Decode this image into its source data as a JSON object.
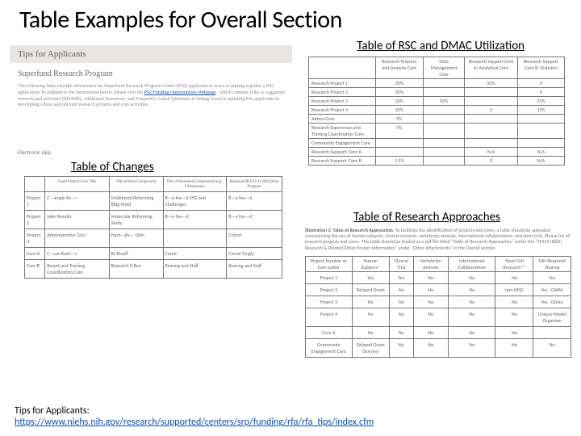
{
  "title": "Table Examples for Overall Section",
  "subheads": {
    "rsc": "Table of RSC and DMAC Utilization",
    "changes": "Table of Changes",
    "approaches": "Table of Research Approaches"
  },
  "tipsBanner": "Tips for Applicants",
  "srpHead": "Superfund Research Program",
  "srpBody": {
    "t1": "The following links provide information for Superfund Research Program Center (P42) applicants to assist in putting together a P42 application. In addition to the information below, please visit the ",
    "link": "P42 Funding Opportunities Webpage",
    "t2": ", which contains links to suggested research and activities (BH4DB), Additional Resources, and Frequently Asked Questions (Coming Soon) to assisting P42 applicants in developing robust and relevant research projects and core activities."
  },
  "elecApp": "Electronic App",
  "rsc": {
    "head": [
      "",
      "Research Projects and Analysis Core",
      "Data Management Core",
      "Research Support Core A: Analytical Core",
      "Research Support Core B: Statistics"
    ],
    "rows": [
      [
        "Research Project 1",
        "20%",
        "",
        "50%",
        "0"
      ],
      [
        "Research Project 2",
        "20%",
        "",
        "",
        "0"
      ],
      [
        "Research Project 3",
        "20%",
        "50%",
        "",
        "33%"
      ],
      [
        "Research Project 4",
        "20%",
        "",
        "C",
        "33%"
      ],
      [
        "Admin Core",
        "5%",
        "",
        "",
        ""
      ],
      [
        "Research Experience and Training Coordination Core",
        "5%",
        "",
        "",
        ""
      ],
      [
        "Community Engagement Core",
        "",
        "",
        "",
        ""
      ],
      [
        "Research Support: Core A",
        "",
        "",
        "N/A",
        "N/A"
      ],
      [
        "Research Support: Core B",
        "2.5%",
        "",
        "0",
        "N/A"
      ]
    ]
  },
  "changes": {
    "head": [
      "",
      "Grant Project Core Title",
      "Title of New Component",
      "Title of Renewed Component (e.g., P42xxxxxxx)",
      "Renewal (RFA ES 14-002) New Program "
    ],
    "rows": [
      [
        "Project 1",
        "C—single Rx—r",
        "Multifaced Reforming Bldg Mold",
        "B—e hw—d S9G and Challenges",
        "B—e hw—d"
      ],
      [
        "Project 2",
        "Infer Results",
        "Molecular Reforming Study",
        "B—e hw—d",
        "B—e hw—d"
      ],
      [
        "Project 3",
        "Administrative Core",
        "Hunt—Rx— Odin",
        "",
        "Cohort"
      ],
      [
        "Core A",
        "C—uw Rush—r",
        "Rx Bvmfl",
        "Count",
        "Count/Trngly"
      ],
      [
        "Core B",
        "Resort and Training Coordination Core",
        "Research 8.Ron",
        "Rearing and Staff",
        "Rearing and Staff"
      ]
    ]
  },
  "approachesIntro": {
    "label": "Illustration 3: Table of Research Approaches.",
    "body": " To facilitate the identification of projects and cores, a table should be uploaded summarizing the use of human subjects, clinical research, vertebrate animals, international collaborations, and stem cells. Please list all research projects and cores. This table should be loaded as a pdf file titled \"Table of Research Approaches\" under the \"SF424 (R&R) Research & Related Other Project Information\" under \"Other Attachments\" in the Overall section."
  },
  "approaches": {
    "head": [
      "Project Number or Core Letter",
      "Human Subjects*",
      "Clinical Trial",
      "Vertebrate Animals",
      "International Collaborations",
      "Stem Cell Research**",
      "NIH-Required Sharing"
    ],
    "rows": [
      [
        "Project 1",
        "Yes",
        "Yes",
        "Yes",
        "Yes",
        "No",
        "Yes"
      ],
      [
        "Project 2",
        "Delayed Onset",
        "No",
        "No",
        "No",
        "non-hESC",
        "Yes - GWAS"
      ],
      [
        "Project 3",
        "No",
        "No",
        "Yes",
        "No",
        "No",
        "Yes - Omics"
      ],
      [
        "Project 4",
        "No",
        "No",
        "No",
        "No",
        "No",
        "Unique Model Organism"
      ],
      [
        "Core A",
        "No",
        "No",
        "No",
        "No",
        "No",
        ""
      ],
      [
        "Community Engagement Core",
        "Delayed Onset (Survey)",
        "No",
        "No",
        "Yes",
        "No",
        "No"
      ]
    ]
  },
  "footer": {
    "label": "Tips for Applicants:",
    "url": "https://www.niehs.nih.gov/research/supported/centers/srp/funding/rfa/rfa_tips/index.cfm"
  }
}
